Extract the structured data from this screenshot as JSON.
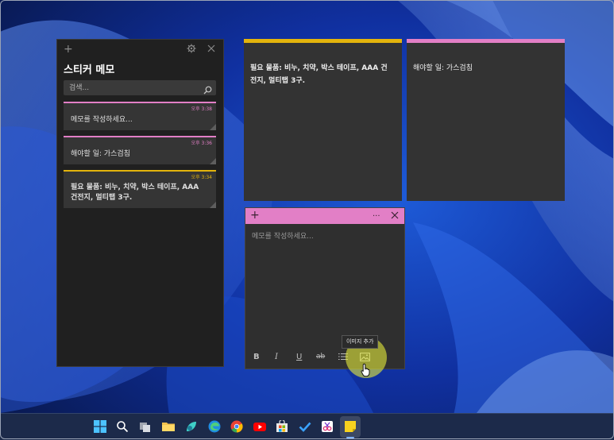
{
  "list_window": {
    "title": "스티커 메모",
    "search_placeholder": "검색...",
    "notes": [
      {
        "time": "오후 3:38",
        "text": "메모를 작성하세요..."
      },
      {
        "time": "오후 3:36",
        "text": "해야할 일: 가스검침"
      },
      {
        "time": "오후 3:34",
        "text_line1": "필요 물품: 비누, 치약, 박스 테이프,  AAA",
        "text_line2": "건전지, 멀티탭 3구."
      }
    ]
  },
  "open_notes": {
    "yellow": {
      "line1": "필요 물품: 비누, 치약, 박스 테이프,  AAA 건",
      "line2": "전지, 멀티탭 3구."
    },
    "pink": {
      "text": "해야할 일: 가스검침"
    }
  },
  "editor": {
    "placeholder": "메모를 작성하세요...",
    "toolbar": {
      "bold": "B",
      "italic": "I",
      "underline": "U",
      "strike": "ab"
    },
    "tooltip": "이미지 추가"
  },
  "colors": {
    "pink": "#e27fc6",
    "yellow": "#e3b40c",
    "note_bg": "#333333"
  },
  "taskbar_icons": [
    "windows-start-icon",
    "search-icon",
    "task-view-icon",
    "file-explorer-icon",
    "widgets-icon",
    "edge-icon",
    "chrome-icon",
    "youtube-icon",
    "store-icon",
    "todo-icon",
    "snipping-icon",
    "sticky-notes-icon"
  ]
}
